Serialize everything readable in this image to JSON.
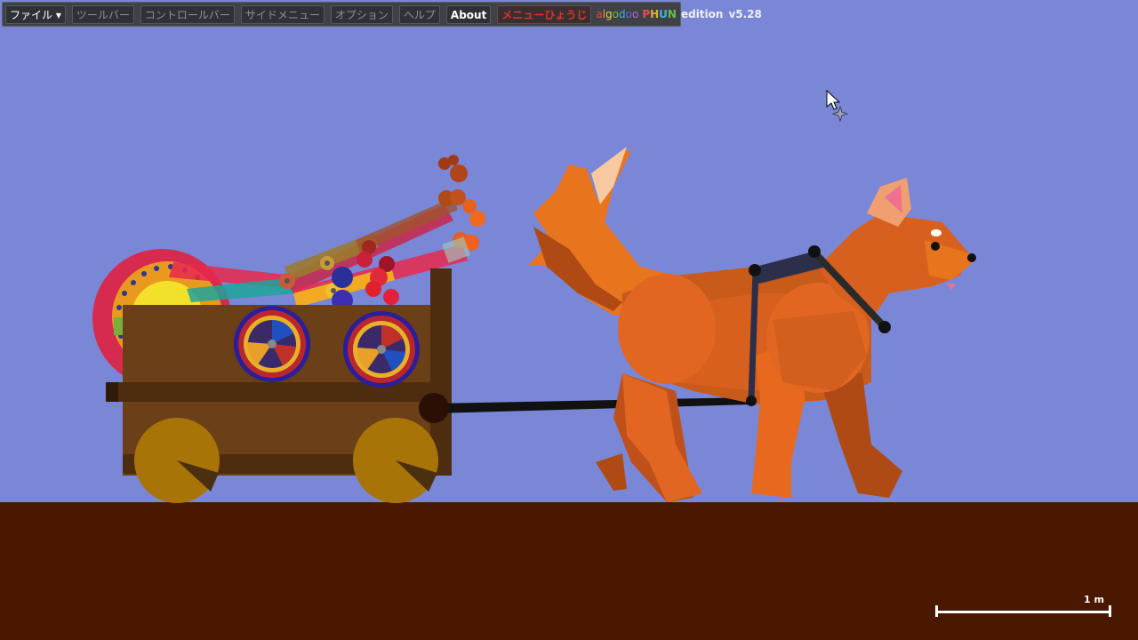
{
  "menu": {
    "items": [
      {
        "label": "ファイル ▾",
        "state": "active"
      },
      {
        "label": "ツールバー",
        "state": "disabled"
      },
      {
        "label": "コントロールバー",
        "state": "disabled"
      },
      {
        "label": "サイドメニュー",
        "state": "disabled"
      },
      {
        "label": "オプション",
        "state": "disabled"
      },
      {
        "label": "ヘルプ",
        "state": "disabled"
      },
      {
        "label": "About",
        "state": "active"
      },
      {
        "label": "メニューひょうじ",
        "state": "highlight"
      }
    ],
    "brand": {
      "letters": [
        "a",
        "l",
        "g",
        "o",
        "d",
        "o",
        "o"
      ],
      "letter_colors": [
        "#E04A3A",
        "#F0A030",
        "#E8D040",
        "#60C050",
        "#40B0E0",
        "#5070E0",
        "#C060D0"
      ],
      "phun": [
        "P",
        "H",
        "U",
        "N"
      ],
      "phun_colors": [
        "#E05050",
        "#E0B030",
        "#40B0E0",
        "#60C050"
      ],
      "edition": "edition",
      "version": "v5.28"
    }
  },
  "scale_bar": {
    "label": "1 m"
  },
  "colors": {
    "sky": "#7A87D7",
    "ground": "#4A1700",
    "cart": "#6B3F17",
    "cart_dark": "#4E2C10",
    "wheel": "#A87408",
    "dog": "#E06622",
    "dog_dark": "#B04A14",
    "harness": "#2B2F4A"
  },
  "icons": {
    "cursor": "arrow-cursor-icon",
    "move": "move-crosshair-icon"
  }
}
